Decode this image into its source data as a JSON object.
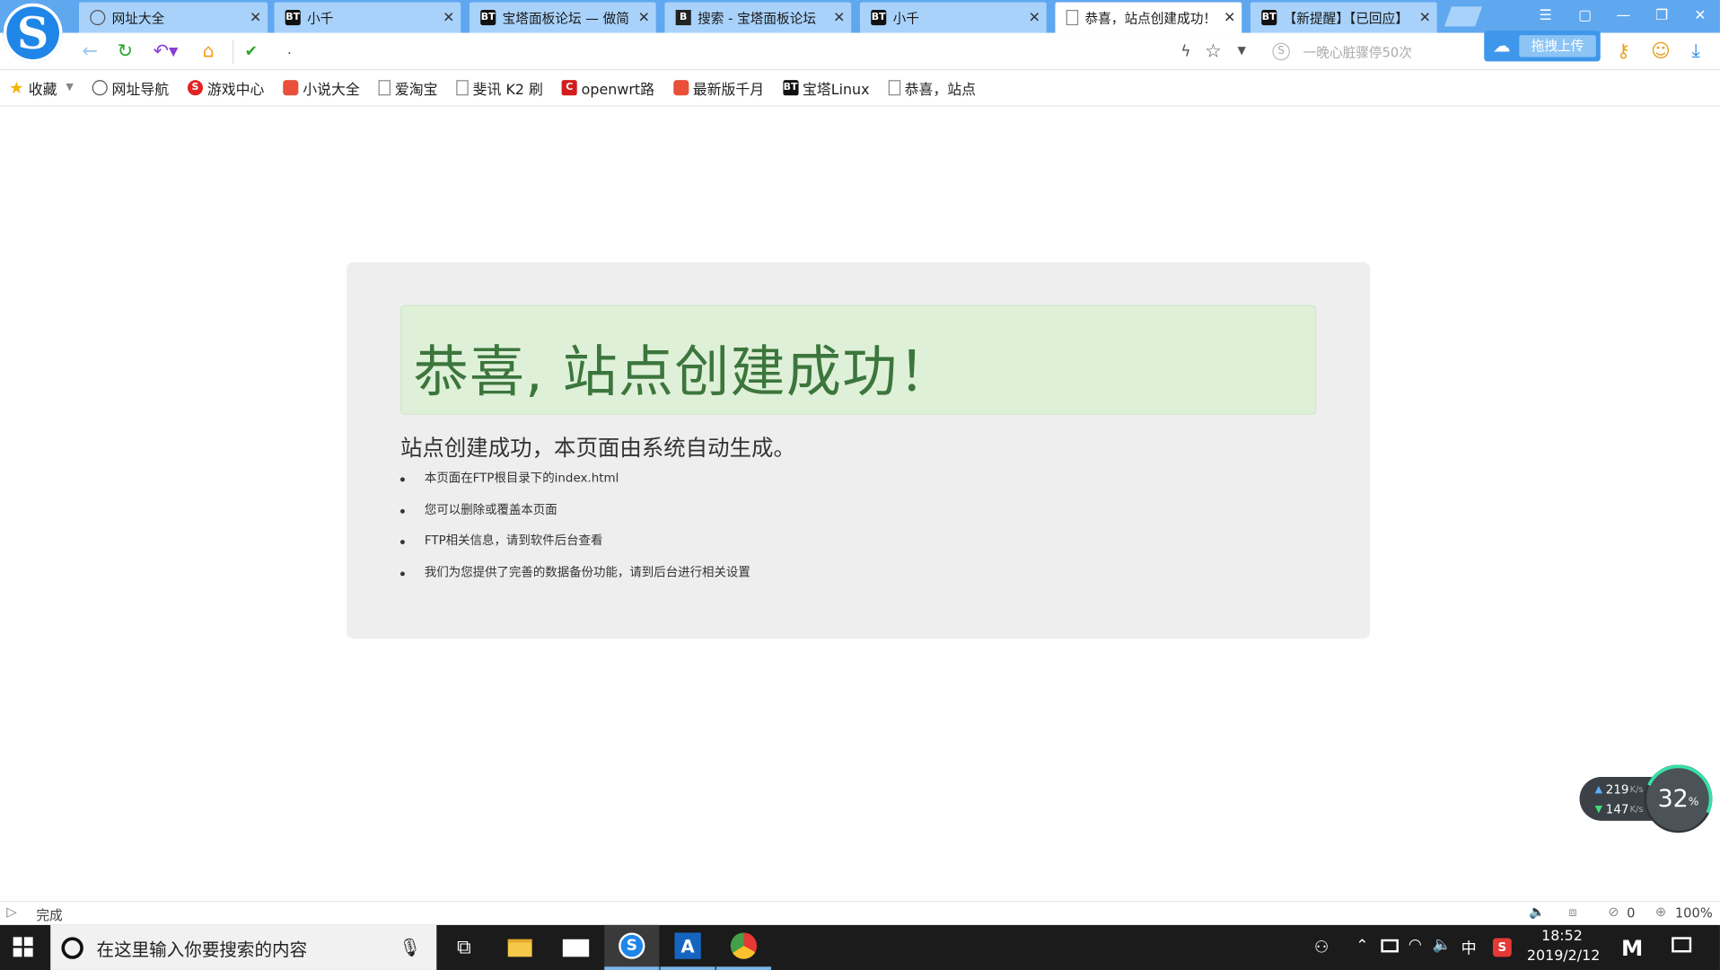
{
  "tabs": [
    {
      "title": "网址大全",
      "icon": "globe-icon"
    },
    {
      "title": "小千",
      "icon": "bt-icon"
    },
    {
      "title": "宝塔面板论坛 — 做简",
      "icon": "bt-icon"
    },
    {
      "title": "搜索 - 宝塔面板论坛",
      "icon": "bt-search-icon"
    },
    {
      "title": "小千",
      "icon": "bt-icon"
    },
    {
      "title": "恭喜，站点创建成功！",
      "icon": "document-icon",
      "active": true
    },
    {
      "title": "【新提醒】【已回应】",
      "icon": "bt-icon"
    }
  ],
  "address": {
    "url": "."
  },
  "search": {
    "placeholder": "一晚心脏骤停50次"
  },
  "upload": {
    "label": "拖拽上传"
  },
  "bookmarks": [
    {
      "label": "收藏",
      "icon": "star-icon"
    },
    {
      "label": "网址导航",
      "icon": "globe-icon"
    },
    {
      "label": "游戏中心",
      "icon": "game-icon"
    },
    {
      "label": "小说大全",
      "icon": "novel-icon"
    },
    {
      "label": "爱淘宝",
      "icon": "document-icon"
    },
    {
      "label": "斐讯 K2 刷",
      "icon": "document-icon"
    },
    {
      "label": "openwrt路",
      "icon": "c-icon"
    },
    {
      "label": "最新版千月",
      "icon": "app-icon"
    },
    {
      "label": "宝塔Linux",
      "icon": "bt-icon"
    },
    {
      "label": "恭喜，站点",
      "icon": "document-icon"
    }
  ],
  "page": {
    "heading": "恭喜, 站点创建成功！",
    "subtitle": "站点创建成功，本页面由系统自动生成。",
    "items": [
      "本页面在FTP根目录下的index.html",
      "您可以删除或覆盖本页面",
      "FTP相关信息，请到软件后台查看",
      "我们为您提供了完善的数据备份功能，请到后台进行相关设置"
    ]
  },
  "statusbar": {
    "text": "完成",
    "adblock_count": "0",
    "zoom": "100%"
  },
  "netmonitor": {
    "up": "219",
    "down": "147",
    "unit": "K/s",
    "percent": "32",
    "percent_unit": "%"
  },
  "taskbar": {
    "search_placeholder": "在这里输入你要搜索的内容",
    "ime": "中",
    "time": "18:52",
    "date": "2019/2/12"
  },
  "colors": {
    "tabbar": "#5fa8f0",
    "hero_bg": "#dff0d8",
    "hero_text": "#3c763d",
    "panel_bg": "#eeeeee"
  }
}
